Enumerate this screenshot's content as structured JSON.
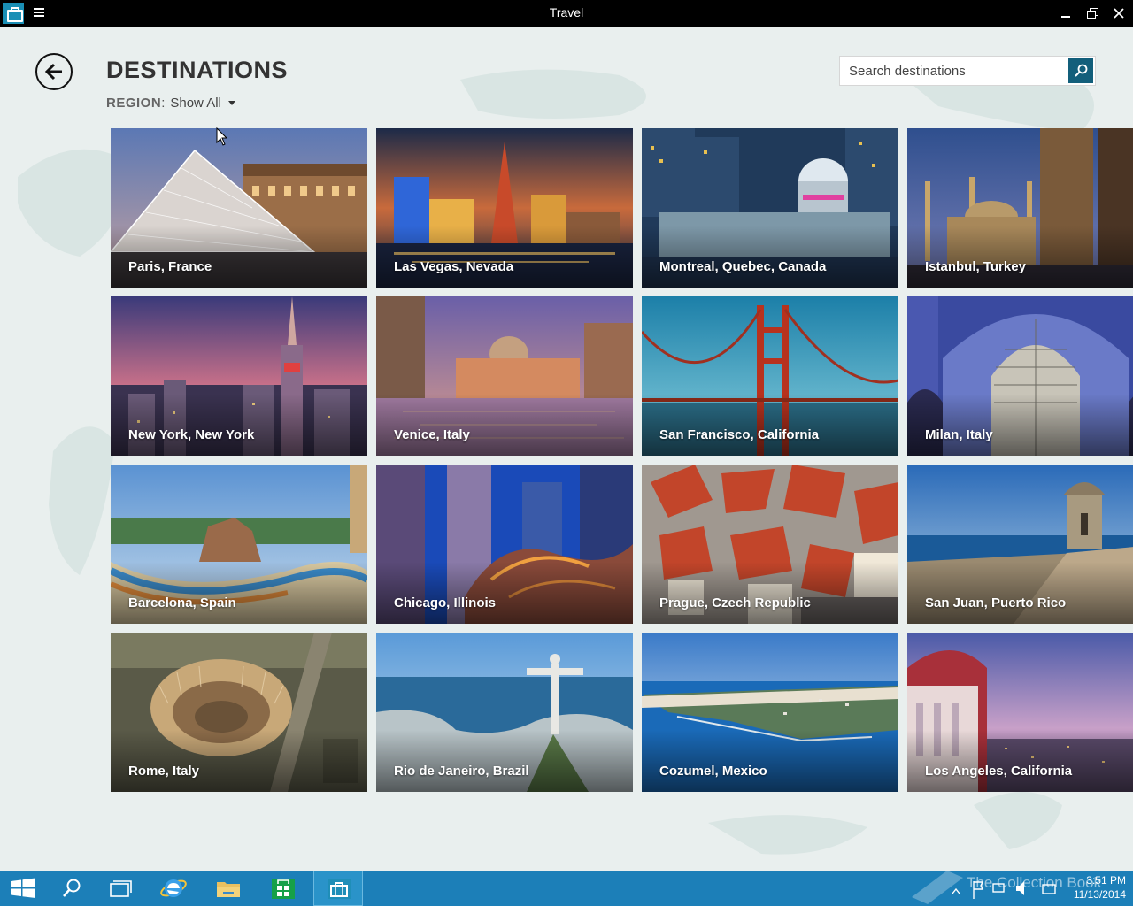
{
  "window": {
    "title": "Travel"
  },
  "header": {
    "page_title": "DESTINATIONS",
    "region_label": "REGION",
    "region_colon": ":",
    "region_value": "Show All"
  },
  "search": {
    "placeholder": "Search destinations"
  },
  "destinations": [
    {
      "label": "Paris, France",
      "icon": "paris-image"
    },
    {
      "label": "Las Vegas, Nevada",
      "icon": "las-vegas-image"
    },
    {
      "label": "Montreal, Quebec, Canada",
      "icon": "montreal-image"
    },
    {
      "label": "Istanbul, Turkey",
      "icon": "istanbul-image"
    },
    {
      "label": "New York, New York",
      "icon": "new-york-image"
    },
    {
      "label": "Venice, Italy",
      "icon": "venice-image"
    },
    {
      "label": "San Francisco, California",
      "icon": "san-francisco-image"
    },
    {
      "label": "Milan, Italy",
      "icon": "milan-image"
    },
    {
      "label": "Barcelona, Spain",
      "icon": "barcelona-image"
    },
    {
      "label": "Chicago, Illinois",
      "icon": "chicago-image"
    },
    {
      "label": "Prague, Czech Republic",
      "icon": "prague-image"
    },
    {
      "label": "San Juan, Puerto Rico",
      "icon": "san-juan-image"
    },
    {
      "label": "Rome, Italy",
      "icon": "rome-image"
    },
    {
      "label": "Rio de Janeiro, Brazil",
      "icon": "rio-image"
    },
    {
      "label": "Cozumel, Mexico",
      "icon": "cozumel-image"
    },
    {
      "label": "Los Angeles, California",
      "icon": "los-angeles-image"
    }
  ],
  "taskbar": {
    "clock_time": "3:51 PM",
    "clock_date": "11/13/2014",
    "watermark": "The Collection Book",
    "items": [
      "start-icon",
      "search-icon",
      "task-view-icon",
      "internet-explorer-icon",
      "file-explorer-icon",
      "store-icon",
      "travel-app-icon"
    ]
  },
  "colors": {
    "titlebar": "#000000",
    "taskbar": "#1c7fb8",
    "accent": "#135f7b",
    "background": "#e9efee"
  }
}
